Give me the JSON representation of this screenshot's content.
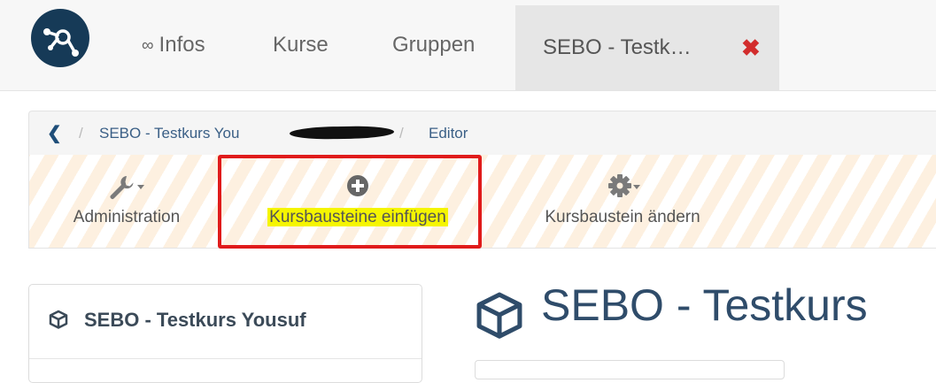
{
  "topnav": {
    "infos_prefix": "∞",
    "infos_label": "Infos",
    "courses_label": "Kurse",
    "groups_label": "Gruppen",
    "active_tab_label": "SEBO - Testk…",
    "close_glyph": "✖",
    "brand_color": "#163a57"
  },
  "breadcrumb": {
    "back_glyph": "❮",
    "separator": "/",
    "course": "SEBO - Testkurs You",
    "editor": "Editor"
  },
  "toolbar": {
    "admin_label": "Administration",
    "insert_label": "Kursbausteine einfügen",
    "change_label": "Kursbaustein ändern",
    "admin_icon": "wrench-icon",
    "insert_icon": "plus-circle-icon",
    "change_icon": "gear-icon",
    "highlight_color": "#e01b1b"
  },
  "sidebar": {
    "title": "SEBO - Testkurs Yousuf",
    "icon": "cube-icon"
  },
  "main": {
    "title": "SEBO - Testkurs",
    "icon": "cube-icon"
  }
}
